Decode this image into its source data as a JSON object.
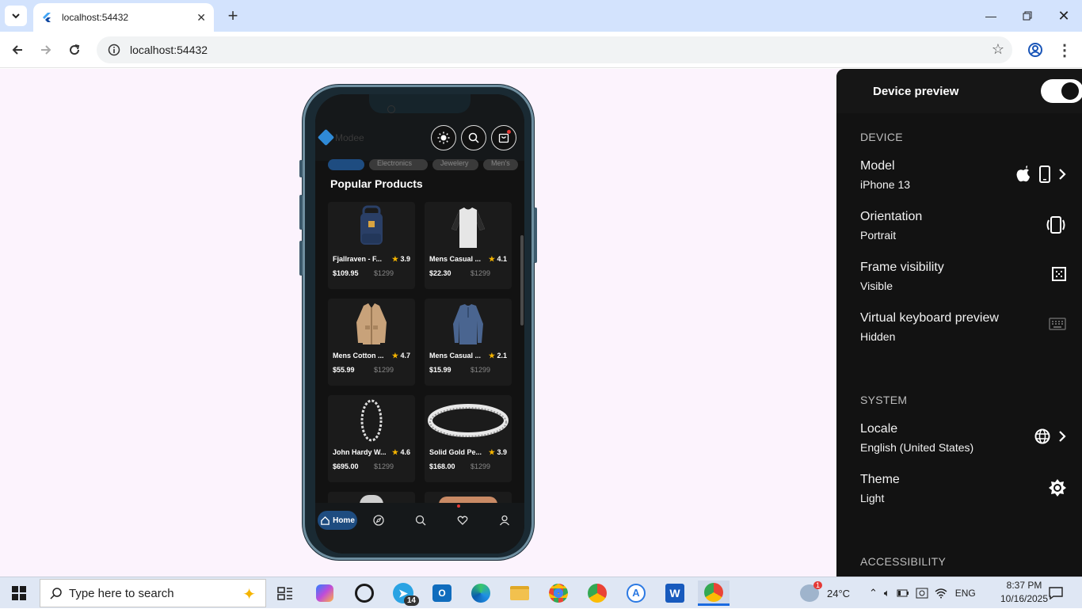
{
  "browser": {
    "tab_title": "localhost:54432",
    "url": "localhost:54432"
  },
  "phone_app": {
    "app_name": "Modee",
    "chips": [
      "All",
      "Electronics",
      "Jewelery",
      "Men's"
    ],
    "section_title": "Popular Products",
    "products": [
      {
        "name": "Fjallraven - F...",
        "rating": "3.9",
        "price": "$109.95",
        "old_price": "$1299",
        "image": "backpack"
      },
      {
        "name": "Mens Casual ...",
        "rating": "4.1",
        "price": "$22.30",
        "old_price": "$1299",
        "image": "raglan-shirt"
      },
      {
        "name": "Mens Cotton ...",
        "rating": "4.7",
        "price": "$55.99",
        "old_price": "$1299",
        "image": "cotton-jacket"
      },
      {
        "name": "Mens Casual ...",
        "rating": "2.1",
        "price": "$15.99",
        "old_price": "$1299",
        "image": "slim-shirt"
      },
      {
        "name": "John Hardy W...",
        "rating": "4.6",
        "price": "$695.00",
        "old_price": "$1299",
        "image": "bracelet"
      },
      {
        "name": "Solid Gold Pe...",
        "rating": "3.9",
        "price": "$168.00",
        "old_price": "$1299",
        "image": "ring"
      }
    ],
    "bottom_nav": {
      "home_label": "Home"
    }
  },
  "device_preview": {
    "title": "Device preview",
    "enabled": true,
    "sections": {
      "device": "DEVICE",
      "system": "SYSTEM",
      "accessibility": "ACCESSIBILITY"
    },
    "model": {
      "label": "Model",
      "value": "iPhone 13"
    },
    "orientation": {
      "label": "Orientation",
      "value": "Portrait"
    },
    "frame": {
      "label": "Frame visibility",
      "value": "Visible"
    },
    "keyboard": {
      "label": "Virtual keyboard preview",
      "value": "Hidden"
    },
    "locale": {
      "label": "Locale",
      "value": "English (United States)"
    },
    "theme": {
      "label": "Theme",
      "value": "Light"
    }
  },
  "taskbar": {
    "search_placeholder": "Type here to search",
    "telegram_badge": "14",
    "weather_badge": "1",
    "temperature": "24°C",
    "language": "ENG",
    "time": "8:37 PM",
    "date": "10/16/2025"
  },
  "colors": {
    "accent": "#1e4c80",
    "panel_bg": "#121212",
    "page_bg": "#fcf3fd",
    "star": "#f5b400"
  }
}
